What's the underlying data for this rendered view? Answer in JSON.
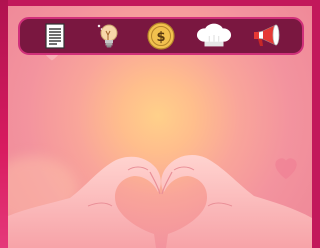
{
  "toolbar": {
    "items": [
      {
        "icon": "document-icon"
      },
      {
        "icon": "lightbulb-icon"
      },
      {
        "icon": "dollar-coin-icon"
      },
      {
        "icon": "chef-hat-icon"
      },
      {
        "icon": "megaphone-icon"
      }
    ]
  },
  "colors": {
    "frame": "#c2185b",
    "toolbar_bg": "#7a1740",
    "toolbar_border": "#d0307a",
    "coin": "#f2c14e",
    "megaphone": "#e53935"
  },
  "background": {
    "image": "hands-making-heart-shape"
  }
}
